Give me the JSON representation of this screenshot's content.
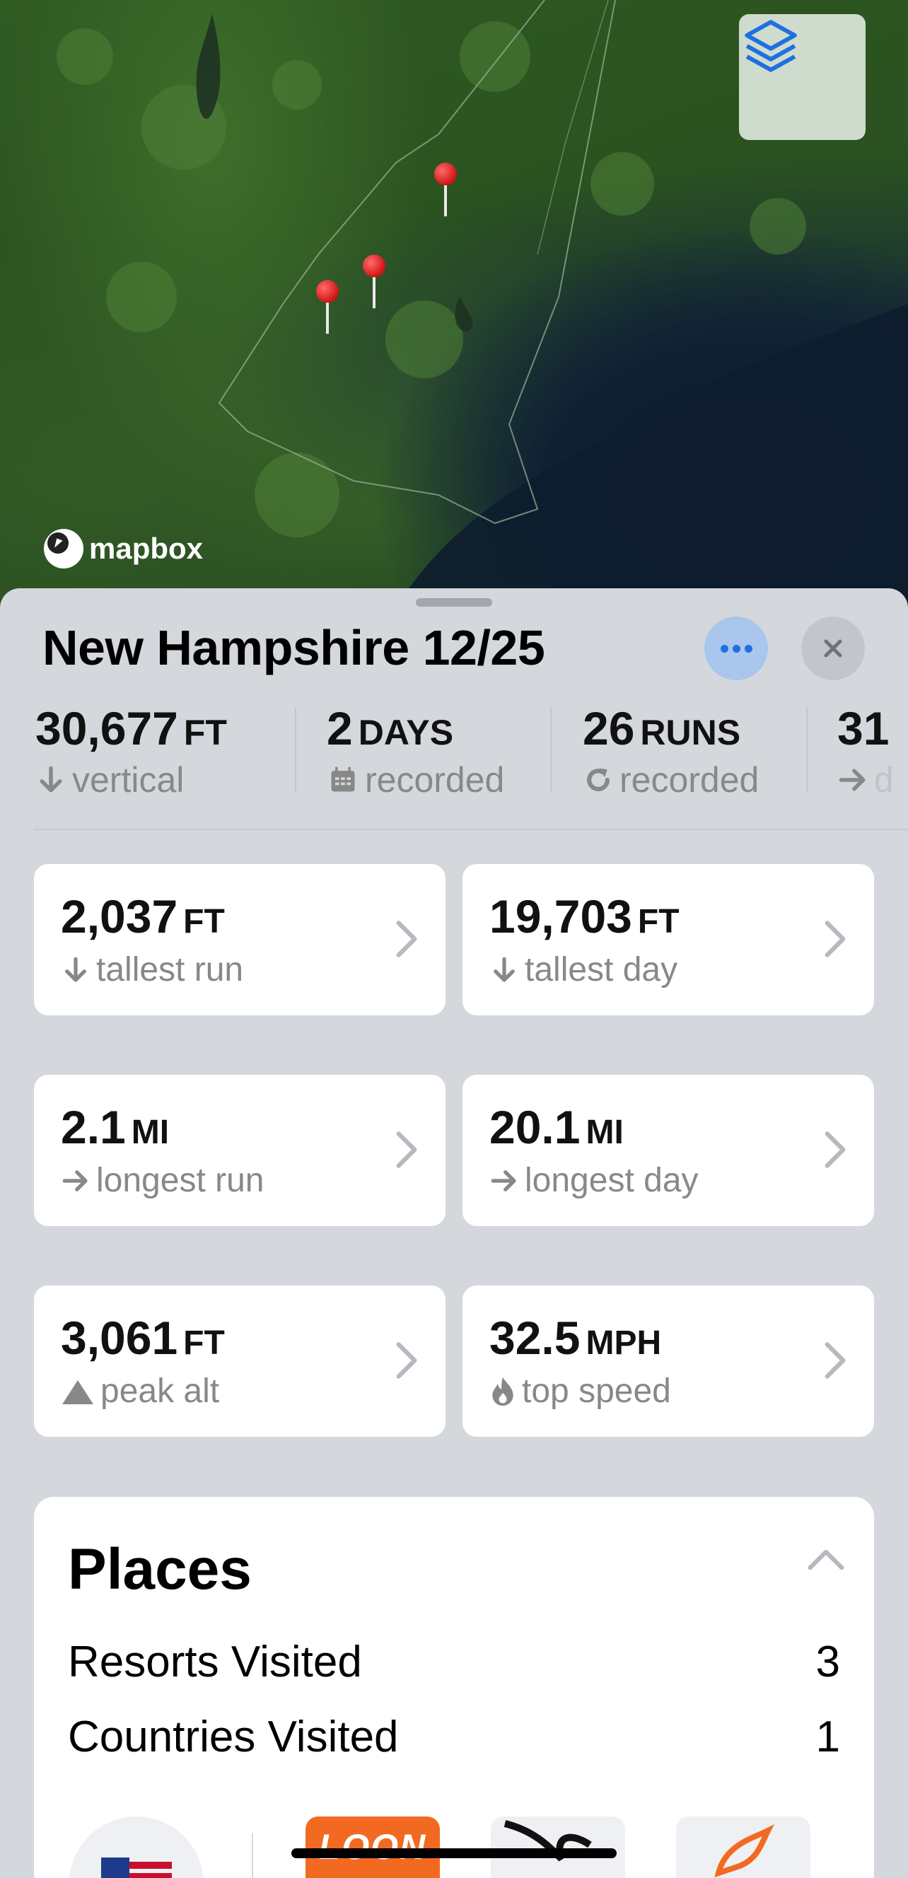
{
  "map": {
    "attribution": "mapbox",
    "layers_icon": "layers-icon",
    "pin_count": 3
  },
  "sheet": {
    "title": "New Hampshire 12/25",
    "summary": [
      {
        "value": "30,677",
        "unit": "FT",
        "label": "vertical",
        "icon": "arrow-down-icon"
      },
      {
        "value": "2",
        "unit": "DAYS",
        "label": "recorded",
        "icon": "calendar-icon"
      },
      {
        "value": "26",
        "unit": "RUNS",
        "label": "recorded",
        "icon": "refresh-icon"
      },
      {
        "value": "31",
        "unit": "",
        "label": "d",
        "icon": "arrow-right-icon"
      }
    ],
    "cards": [
      {
        "value": "2,037",
        "unit": "FT",
        "label": "tallest run",
        "icon": "arrow-down-icon"
      },
      {
        "value": "19,703",
        "unit": "FT",
        "label": "tallest day",
        "icon": "arrow-down-icon"
      },
      {
        "value": "2.1",
        "unit": "MI",
        "label": "longest run",
        "icon": "arrow-right-icon"
      },
      {
        "value": "20.1",
        "unit": "MI",
        "label": "longest day",
        "icon": "arrow-right-icon"
      },
      {
        "value": "3,061",
        "unit": "FT",
        "label": "peak alt",
        "icon": "mountain-icon"
      },
      {
        "value": "32.5",
        "unit": "MPH",
        "label": "top speed",
        "icon": "flame-icon"
      }
    ],
    "places": {
      "title": "Places",
      "rows": [
        {
          "label": "Resorts Visited",
          "value": "3"
        },
        {
          "label": "Countries Visited",
          "value": "1"
        }
      ],
      "logo_fragment": "LOON"
    }
  },
  "colors": {
    "accent": "#1f6fe0",
    "pin": "#d11414",
    "card_bg": "#ffffff",
    "sheet_bg": "#d4d8dd",
    "secondary_text": "#888888"
  }
}
